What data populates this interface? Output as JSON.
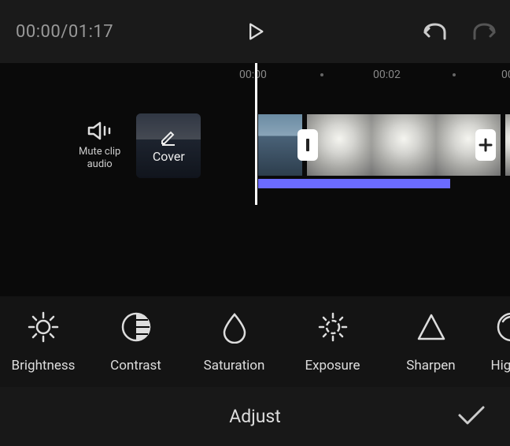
{
  "topbar": {
    "timecode": "00:00/01:17"
  },
  "ruler": {
    "ticks": [
      "00:00",
      "00:02",
      "00"
    ]
  },
  "tools": {
    "mute_label": "Mute clip\naudio",
    "cover_label": "Cover"
  },
  "adjust": {
    "items": [
      {
        "label": "Brightness",
        "icon": "brightness"
      },
      {
        "label": "Contrast",
        "icon": "contrast"
      },
      {
        "label": "Saturation",
        "icon": "saturation"
      },
      {
        "label": "Exposure",
        "icon": "exposure"
      },
      {
        "label": "Sharpen",
        "icon": "sharpen"
      },
      {
        "label": "Highlig",
        "icon": "highlight"
      }
    ]
  },
  "bottom": {
    "title": "Adjust"
  },
  "colors": {
    "accent": "#6b6bff"
  }
}
